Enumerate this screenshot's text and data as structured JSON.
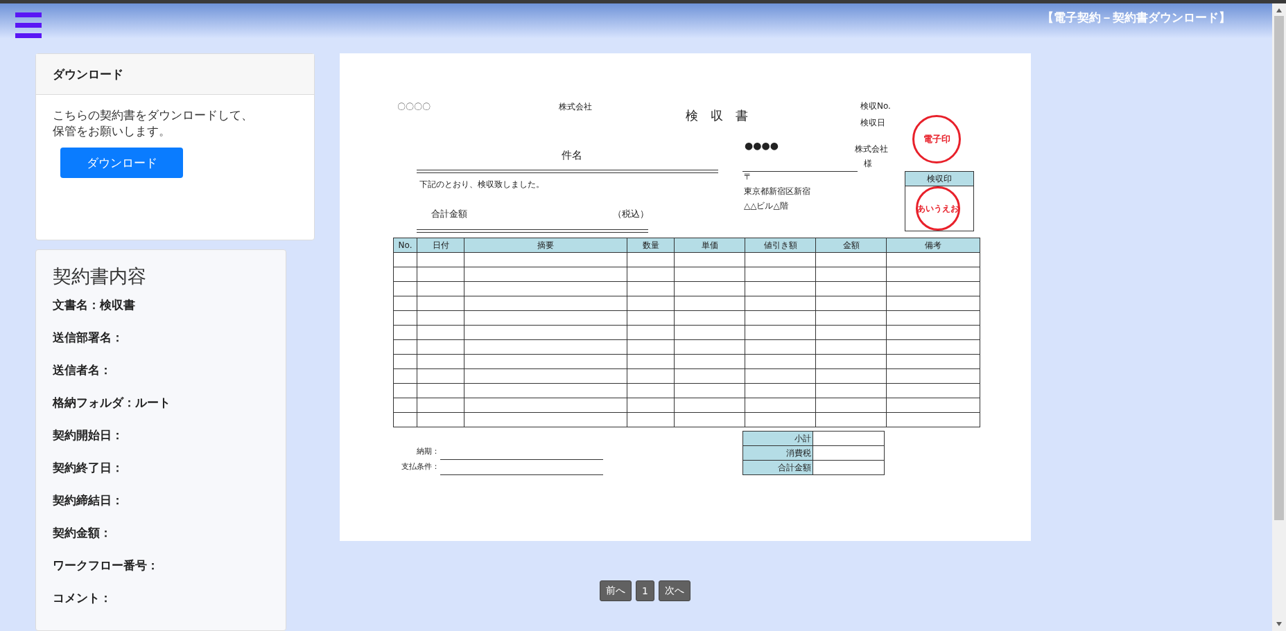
{
  "header": {
    "title": "【電子契約－契約書ダウンロード】"
  },
  "download_card": {
    "title": "ダウンロード",
    "message_lines": [
      "こちらの契約書をダウンロードして、",
      "保管をお願いします。"
    ],
    "button": "ダウンロード"
  },
  "contract_details": {
    "title": "契約書内容",
    "fields": [
      "文書名：検収書",
      "送信部署名：",
      "送信者名：",
      "格納フォルダ：ルート",
      "契約開始日：",
      "契約終了日：",
      "契約締結日：",
      "契約金額：",
      "ワークフロー番号：",
      "コメント："
    ]
  },
  "document": {
    "issuer": "〇〇〇〇",
    "issuer_suffix": "株式会社",
    "title": "検　収　書",
    "meta": [
      "検収No.",
      "検収日"
    ],
    "seal": "電子印",
    "subject": "件名",
    "note": "下記のとおり、検収致しました。",
    "total_label": "合計金額",
    "tax_note": "（税込）",
    "recipient": {
      "name": "●●●●",
      "company": "株式会社",
      "honorific": "様"
    },
    "address": [
      "〒",
      "東京都新宿区新宿",
      "△△ビル△階"
    ],
    "inspection_stamp": {
      "title": "検収印",
      "seal": "あいうえお"
    },
    "columns": [
      "No.",
      "日付",
      "摘要",
      "数量",
      "単価",
      "値引き額",
      "金額",
      "備考"
    ],
    "summary": [
      "小計",
      "消費税",
      "合計金額"
    ],
    "terms": [
      "納期：",
      "支払条件："
    ]
  },
  "pagination": [
    "前へ",
    "1",
    "次へ"
  ]
}
